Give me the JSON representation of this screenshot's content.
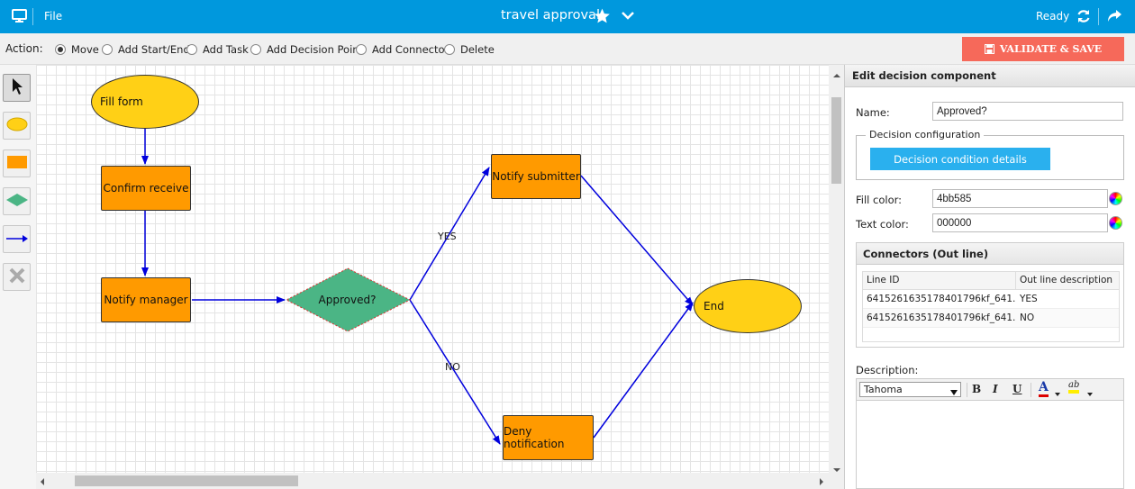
{
  "topbar": {
    "file": "File",
    "title": "travel approval",
    "status": "Ready"
  },
  "toolbar": {
    "action_label": "Action:",
    "options": [
      {
        "label": "Move",
        "selected": true
      },
      {
        "label": "Add Start/End",
        "selected": false
      },
      {
        "label": "Add Task",
        "selected": false
      },
      {
        "label": "Add Decision Point",
        "selected": false
      },
      {
        "label": "Add Connector",
        "selected": false
      },
      {
        "label": "Delete",
        "selected": false
      }
    ],
    "validate_label": "VALIDATE & SAVE"
  },
  "palette": {
    "tools": [
      "pointer-tool",
      "start-end-tool",
      "task-tool",
      "decision-tool",
      "connector-tool",
      "delete-tool"
    ]
  },
  "diagram": {
    "nodes": {
      "fill_form": "Fill form",
      "confirm_receive": "Confirm receive",
      "notify_manager": "Notify manager",
      "approved": "Approved?",
      "notify_submitter": "Notify submitter",
      "deny_notification": "Deny notification",
      "end": "End"
    },
    "edge_labels": {
      "yes": "YES",
      "no": "NO"
    },
    "colors": {
      "task": "#ff9a00",
      "start_end": "#ffd016",
      "decision": "#4bb585",
      "edge": "#0000dd"
    }
  },
  "panel": {
    "header": "Edit decision component",
    "name_label": "Name:",
    "name_value": "Approved?",
    "decision_config_legend": "Decision configuration",
    "decision_button": "Decision condition details",
    "fill_color_label": "Fill color:",
    "fill_color_value": "4bb585",
    "text_color_label": "Text color:",
    "text_color_value": "000000",
    "connectors_header": "Connectors (Out line)",
    "columns": [
      "Line ID",
      "Out line description"
    ],
    "rows": [
      {
        "id": "6415261635178401796kf_641...",
        "desc": "YES"
      },
      {
        "id": "6415261635178401796kf_641...",
        "desc": "NO"
      }
    ],
    "description_label": "Description:",
    "font_value": "Tahoma"
  }
}
